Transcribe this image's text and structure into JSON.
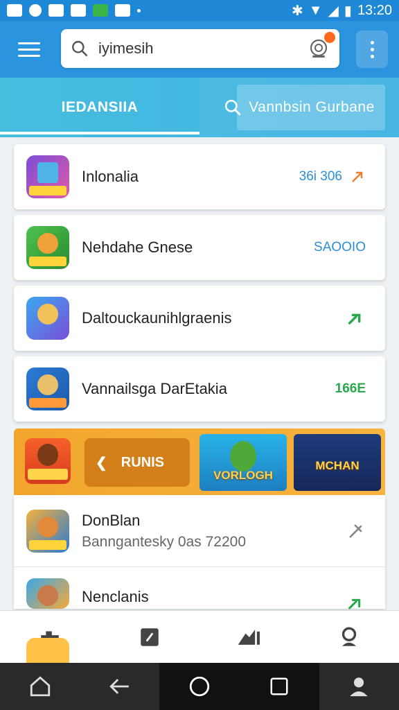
{
  "status_bar": {
    "time": "13:20"
  },
  "search": {
    "value": "iyimesih"
  },
  "tabs": [
    {
      "label": "IEDANSIIA",
      "active": true
    },
    {
      "label": "Vannbsin Gurbane",
      "active": false
    }
  ],
  "apps": [
    {
      "title": "Inlonalia",
      "meta": "36i 306",
      "meta_style": "blue",
      "trailing_icon": "arrow-up-right-icon",
      "icon_tag": "BAINAIS"
    },
    {
      "title": "Nehdahe Gnese",
      "meta": "SAOOIO",
      "meta_style": "blue",
      "icon_tag": "BAOLUS"
    },
    {
      "title": "Daltouckaunihlgraenis",
      "meta": "",
      "meta_style": "green",
      "trailing_icon": "green-arrow-icon"
    },
    {
      "title": "Vannailsga DarEtakia",
      "meta": "166E",
      "meta_style": "green",
      "icon_tag": "SAOCO"
    }
  ],
  "banner": {
    "icon_label": "MEFAIAS",
    "button_label": "RUNIS",
    "promos": [
      "VORLOGH",
      "MCHAN"
    ]
  },
  "list2": [
    {
      "title": "DonBlan",
      "subtitle": "Banngantesky 0as 72200",
      "icon_tag": "BHIIAIS"
    },
    {
      "title": "Nenclanis",
      "subtitle": ""
    }
  ],
  "colors": {
    "appbar": "#2b94de",
    "status_bar": "#1e88d6",
    "tabbar": "#47bde0",
    "banner": "#f2a52d",
    "accent_blue": "#2a8fd8",
    "accent_green": "#2aa84a"
  }
}
